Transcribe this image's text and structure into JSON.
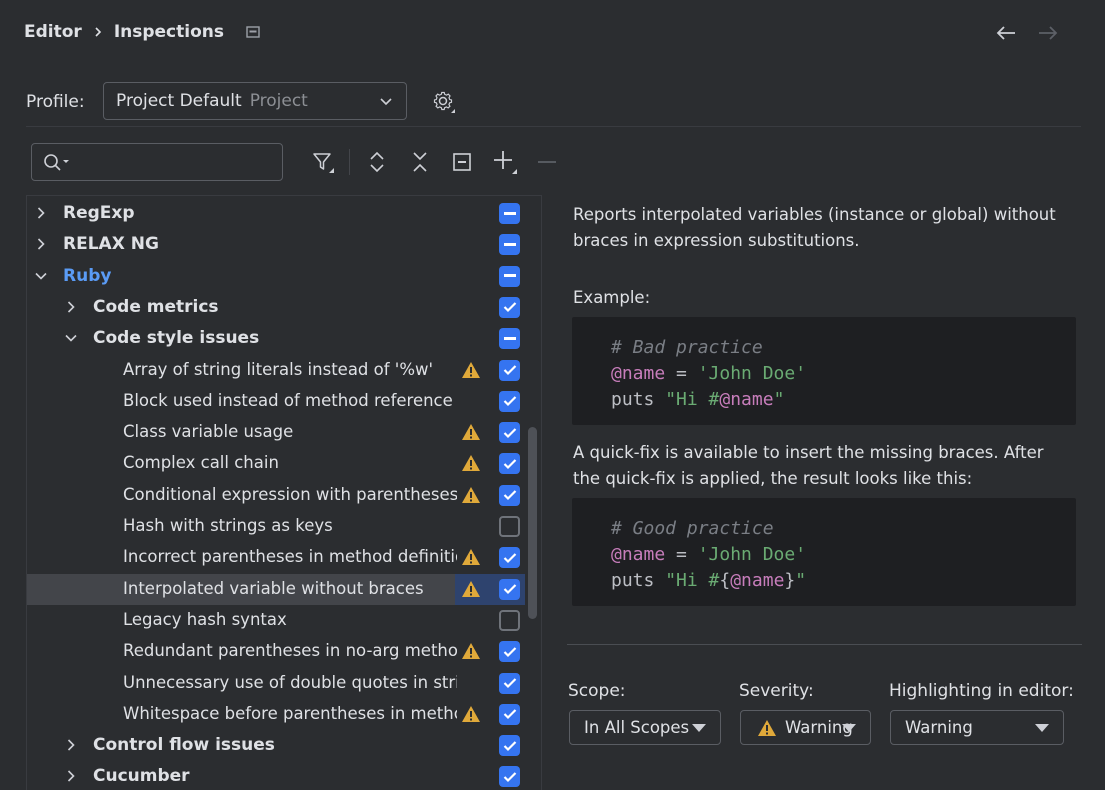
{
  "breadcrumb": {
    "parent": "Editor",
    "current": "Inspections"
  },
  "profile": {
    "label": "Profile:",
    "name": "Project Default",
    "scope": "Project"
  },
  "search": {
    "placeholder": "",
    "value": ""
  },
  "toolbar": [
    "filter-icon",
    "expand-all-icon",
    "collapse-all-icon",
    "reset-icon",
    "add-icon",
    "remove-icon"
  ],
  "tree": [
    {
      "label": "RegExp",
      "level": 0,
      "type": "group",
      "arrow": "right",
      "check": "mixed",
      "warn": false
    },
    {
      "label": "RELAX NG",
      "level": 0,
      "type": "group",
      "arrow": "right",
      "check": "mixed",
      "warn": false
    },
    {
      "label": "Ruby",
      "level": 0,
      "type": "group",
      "arrow": "down",
      "check": "mixed",
      "warn": false,
      "accent": true
    },
    {
      "label": "Code metrics",
      "level": 1,
      "type": "group",
      "arrow": "right",
      "check": "on",
      "warn": false
    },
    {
      "label": "Code style issues",
      "level": 1,
      "type": "group",
      "arrow": "down",
      "check": "mixed",
      "warn": false
    },
    {
      "label": "Array of string literals instead of '%w'",
      "level": 2,
      "type": "item",
      "check": "on",
      "warn": true
    },
    {
      "label": "Block used instead of method reference",
      "level": 2,
      "type": "item",
      "check": "on",
      "warn": false
    },
    {
      "label": "Class variable usage",
      "level": 2,
      "type": "item",
      "check": "on",
      "warn": true
    },
    {
      "label": "Complex call chain",
      "level": 2,
      "type": "item",
      "check": "on",
      "warn": true
    },
    {
      "label": "Conditional expression with parentheses",
      "level": 2,
      "type": "item",
      "check": "on",
      "warn": true
    },
    {
      "label": "Hash with strings as keys",
      "level": 2,
      "type": "item",
      "check": "off",
      "warn": false
    },
    {
      "label": "Incorrect parentheses in method definition",
      "level": 2,
      "type": "item",
      "check": "on",
      "warn": true
    },
    {
      "label": "Interpolated variable without braces",
      "level": 2,
      "type": "item",
      "check": "on",
      "warn": true,
      "selected": true
    },
    {
      "label": "Legacy hash syntax",
      "level": 2,
      "type": "item",
      "check": "off",
      "warn": false
    },
    {
      "label": "Redundant parentheses in no-arg method",
      "level": 2,
      "type": "item",
      "check": "on",
      "warn": true
    },
    {
      "label": "Unnecessary use of double quotes in strir",
      "level": 2,
      "type": "item",
      "check": "on",
      "warn": false
    },
    {
      "label": "Whitespace before parentheses in methoc",
      "level": 2,
      "type": "item",
      "check": "on",
      "warn": true
    },
    {
      "label": "Control flow issues",
      "level": 1,
      "type": "group",
      "arrow": "right",
      "check": "on",
      "warn": false
    },
    {
      "label": "Cucumber",
      "level": 1,
      "type": "group",
      "arrow": "right",
      "check": "on",
      "warn": false
    }
  ],
  "description": {
    "intro": "Reports interpolated variables (instance or global) without braces in expression substitutions.",
    "example_label": "Example:",
    "bad": {
      "comment": "# Bad practice",
      "var": "@name",
      "eq": " = ",
      "str": "'John Doe'",
      "puts": "puts ",
      "s1": "\"Hi #",
      "s2": "\""
    },
    "fix_text": "A quick-fix is available to insert the missing braces. After the quick-fix is applied, the result looks like this:",
    "good": {
      "comment": "# Good practice",
      "var": "@name",
      "eq": " = ",
      "str": "'John Doe'",
      "puts": "puts ",
      "s1": "\"Hi #",
      "b1": "{",
      "b2": "}",
      "s2": "\""
    }
  },
  "settings": {
    "scope_label": "Scope:",
    "scope_value": "In All Scopes",
    "severity_label": "Severity:",
    "severity_value": "Warning",
    "highlight_label": "Highlighting in editor:",
    "highlight_value": "Warning"
  },
  "colors": {
    "accent": "#3574f0",
    "warning": "#e0a93a",
    "ruby": "#5a9bf5"
  }
}
